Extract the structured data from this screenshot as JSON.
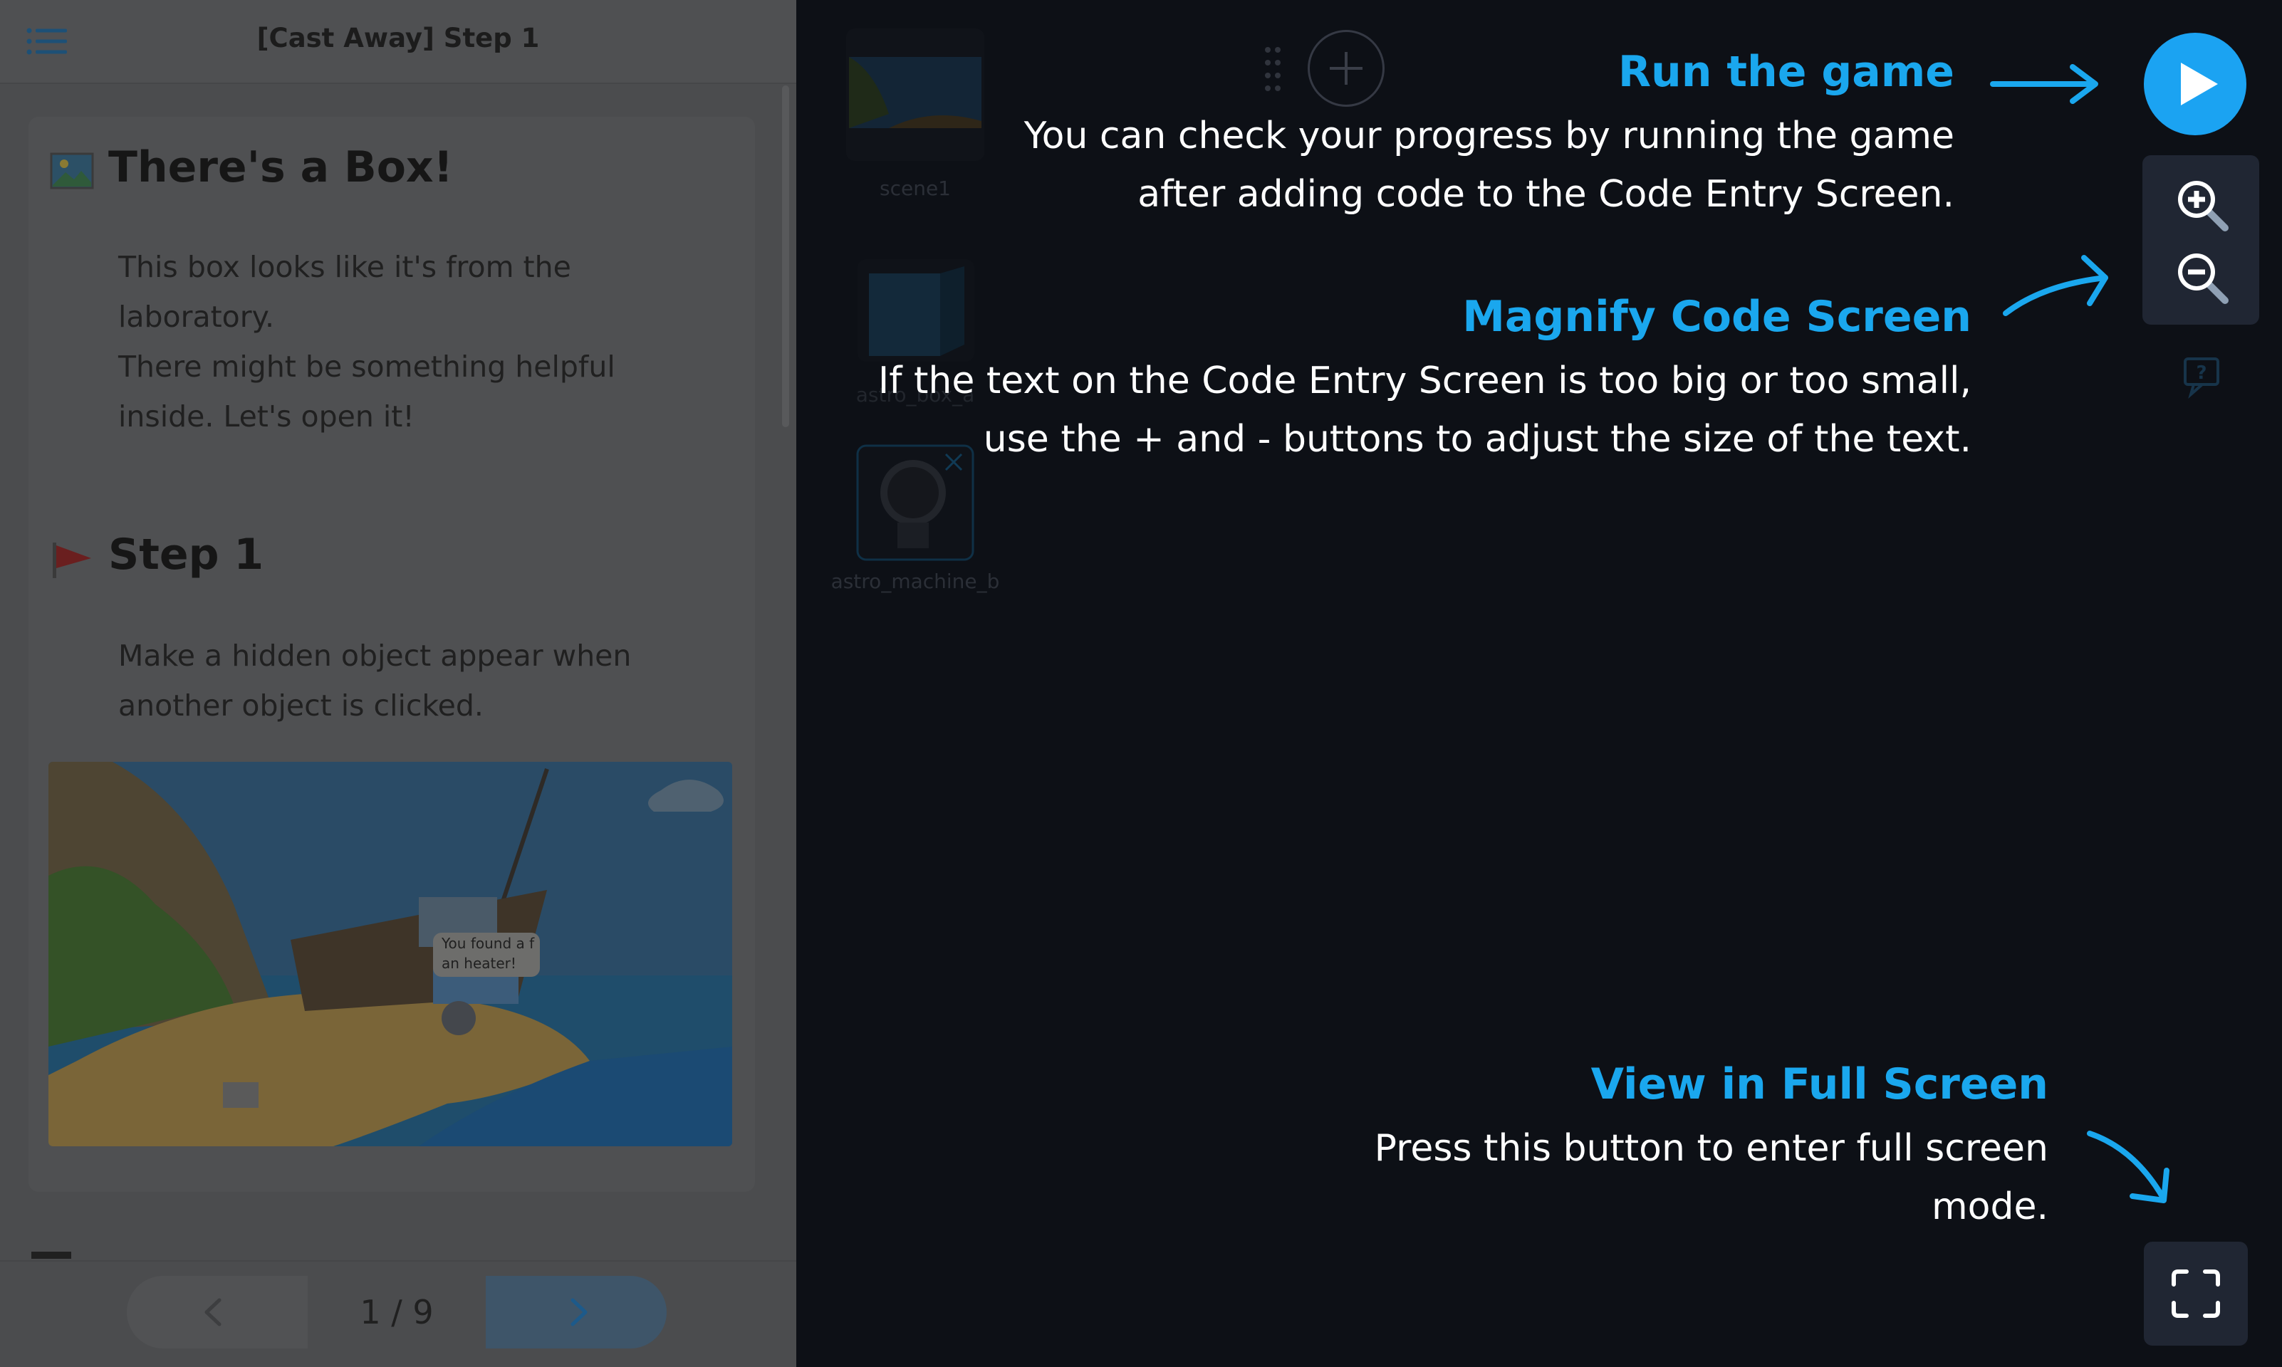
{
  "left_panel": {
    "title": "[Cast Away] Step 1",
    "sections": [
      {
        "title": "There's a Box!",
        "icon": "image-icon",
        "lines": [
          "This box looks like it's from the laboratory.",
          "There might be something helpful inside. Let's open it!"
        ]
      },
      {
        "title": "Step 1",
        "icon": "flag-icon",
        "lines": [
          "Make a hidden object appear when another object is clicked."
        ]
      }
    ],
    "image_caption": "You found a f an heater!",
    "pagination": {
      "current": "1 / 9"
    }
  },
  "workspace": {
    "sprites": [
      {
        "name": "scene1"
      },
      {
        "name": "astro_box_a"
      },
      {
        "name": "astro_machine_b"
      }
    ]
  },
  "callouts": {
    "run": {
      "title": "Run the game",
      "desc": "You can check your progress by running the game after adding code to the Code Entry Screen."
    },
    "magnify": {
      "title": "Magnify Code Screen",
      "desc": "If the text on the Code Entry Screen is too big or too small, use the + and - buttons to adjust the size of the text."
    },
    "fullscreen": {
      "title": "View in Full Screen",
      "desc": "Press this button to enter full screen mode."
    }
  },
  "colors": {
    "accent": "#1aa7ee",
    "play_button": "#1ba3f2",
    "overlay_text": "#ffffff",
    "workspace_bg": "#0d1016"
  },
  "icons": [
    "menu-icon",
    "image-icon",
    "flag-icon",
    "chevron-left-icon",
    "chevron-right-icon",
    "drag-handle-icon",
    "plus-icon",
    "play-icon",
    "zoom-in-icon",
    "zoom-out-icon",
    "help-icon",
    "fullscreen-icon",
    "close-icon"
  ]
}
